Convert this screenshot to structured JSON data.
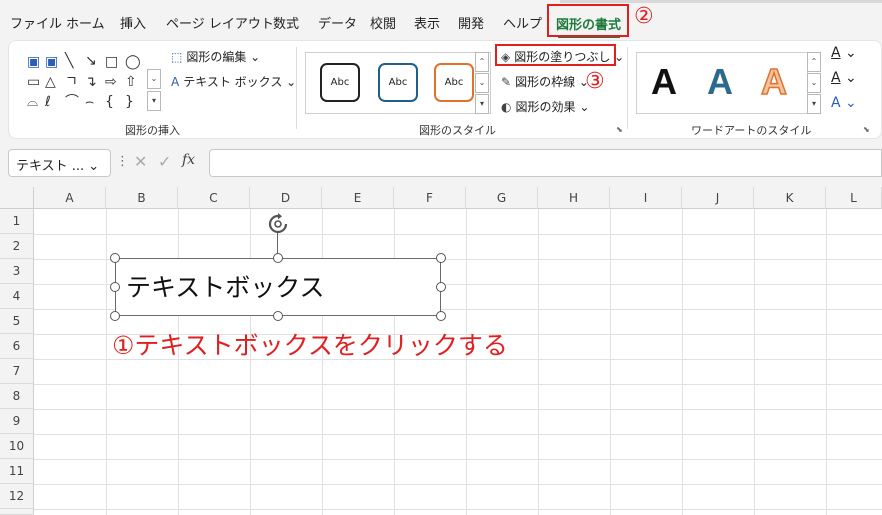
{
  "tabs": [
    "ファイル",
    "ホーム",
    "挿入",
    "ページ レイアウト",
    "数式",
    "データ",
    "校閲",
    "表示",
    "開発",
    "ヘルプ",
    "図形の書式"
  ],
  "active_tab": "図形の書式",
  "callouts": {
    "step2": "②",
    "step3": "③",
    "step1": "①テキストボックスをクリックする"
  },
  "ribbon": {
    "insert_shapes": {
      "edit_shape": "図形の編集",
      "text_box": "テキスト ボックス",
      "label": "図形の挿入"
    },
    "shape_styles": {
      "swatch_text": "Abc",
      "fill": "図形の塗りつぶし",
      "outline": "図形の枠線",
      "effects": "図形の効果",
      "label": "図形のスタイル"
    },
    "wordart": {
      "letter": "A",
      "label": "ワードアートのスタイル"
    }
  },
  "formula_bar": {
    "name_box": "テキスト ...",
    "fx": "fx"
  },
  "columns": [
    "A",
    "B",
    "C",
    "D",
    "E",
    "F",
    "G",
    "H",
    "I",
    "J",
    "K",
    "L"
  ],
  "rows": [
    "1",
    "2",
    "3",
    "4",
    "5",
    "6",
    "7",
    "8",
    "9",
    "10",
    "11",
    "12"
  ],
  "textbox": {
    "content": "テキストボックス"
  },
  "colors": {
    "accent": "#1e7a3c",
    "callout": "#e02020",
    "swatch1": "#222222",
    "swatch2": "#1f5f8b",
    "swatch3": "#e0722a"
  }
}
